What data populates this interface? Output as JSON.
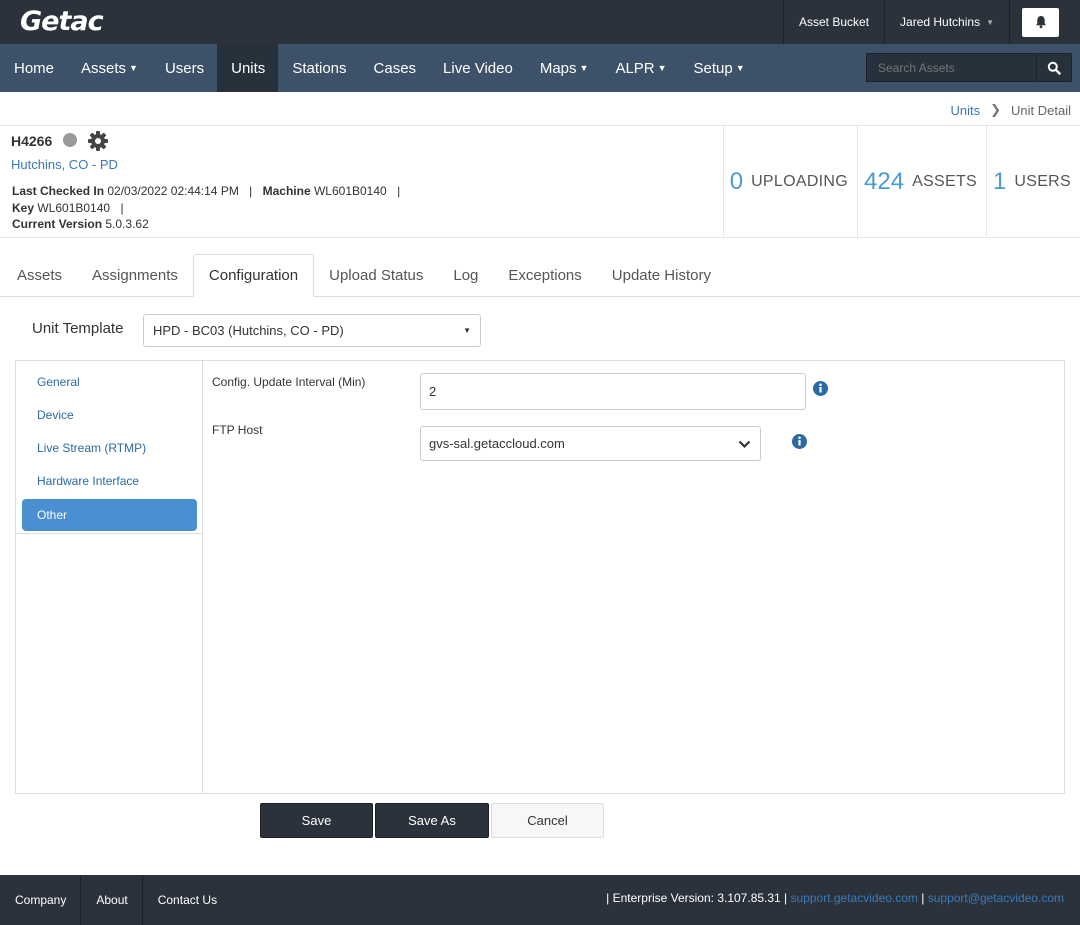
{
  "brand": {
    "logo_text": "Getac"
  },
  "topbar": {
    "asset_bucket": "Asset Bucket",
    "user_name": "Jared Hutchins"
  },
  "nav": {
    "items": [
      {
        "label": "Home",
        "dropdown": false
      },
      {
        "label": "Assets",
        "dropdown": true
      },
      {
        "label": "Users",
        "dropdown": false
      },
      {
        "label": "Units",
        "dropdown": false,
        "active": true
      },
      {
        "label": "Stations",
        "dropdown": false
      },
      {
        "label": "Cases",
        "dropdown": false
      },
      {
        "label": "Live Video",
        "dropdown": false
      },
      {
        "label": "Maps",
        "dropdown": true
      },
      {
        "label": "ALPR",
        "dropdown": true
      },
      {
        "label": "Setup",
        "dropdown": true
      }
    ],
    "search_placeholder": "Search Assets"
  },
  "breadcrumb": {
    "parent": "Units",
    "current": "Unit Detail"
  },
  "unit": {
    "id": "H4266",
    "agency": "Hutchins, CO - PD",
    "last_checked_label": "Last Checked In",
    "last_checked_value": "02/03/2022 02:44:14 PM",
    "machine_label": "Machine",
    "machine_value": "WL601B0140",
    "key_label": "Key",
    "key_value": "WL601B0140",
    "version_label": "Current Version",
    "version_value": "5.0.3.62"
  },
  "stats": [
    {
      "value": "0",
      "label": "UPLOADING"
    },
    {
      "value": "424",
      "label": "ASSETS"
    },
    {
      "value": "1",
      "label": "USERS"
    }
  ],
  "tabs": [
    "Assets",
    "Assignments",
    "Configuration",
    "Upload Status",
    "Log",
    "Exceptions",
    "Update History"
  ],
  "active_tab": "Configuration",
  "template": {
    "label": "Unit Template",
    "value": "HPD - BC03 (Hutchins, CO - PD)"
  },
  "config_sections": [
    "General",
    "Device",
    "Live Stream (RTMP)",
    "Hardware Interface",
    "Other"
  ],
  "active_section": "Other",
  "fields": {
    "interval_label": "Config. Update Interval (Min)",
    "interval_value": "2",
    "ftp_label": "FTP Host",
    "ftp_value": "gvs-sal.getaccloud.com"
  },
  "buttons": {
    "save": "Save",
    "save_as": "Save As",
    "cancel": "Cancel"
  },
  "footer": {
    "links": [
      "Company",
      "About",
      "Contact Us"
    ],
    "version_text": "| Enterprise Version: 3.107.85.31 |",
    "support_site": "support.getacvideo.com",
    "separator": "|",
    "support_email": "support@getacvideo.com"
  },
  "colors": {
    "topbar": "#2b323c",
    "nav": "#3d5168",
    "accent": "#4a8fd2",
    "link": "#3b79b6"
  }
}
